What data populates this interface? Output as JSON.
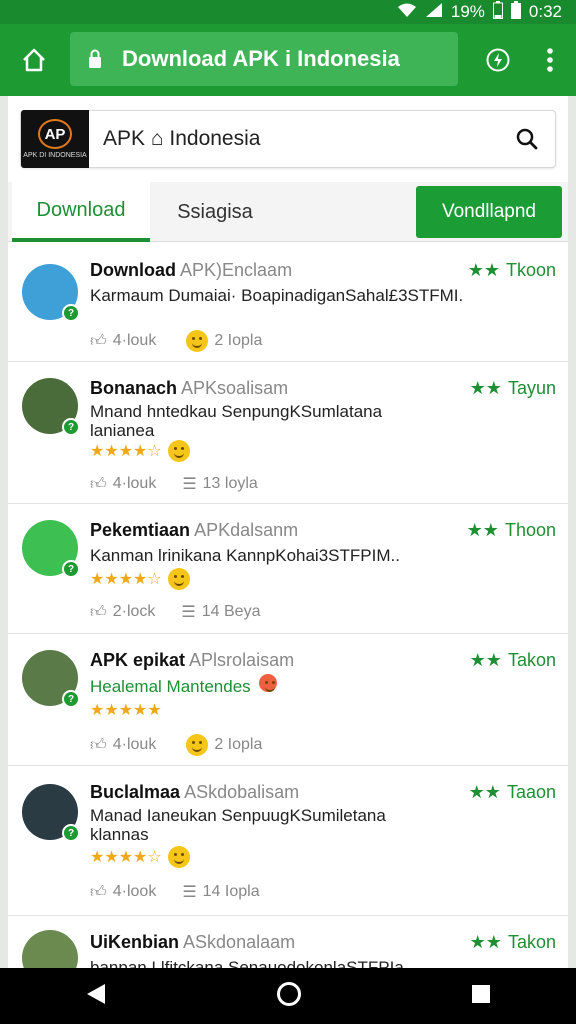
{
  "status_bar": {
    "battery": "19%",
    "time": "0:32"
  },
  "browser": {
    "url_title": "Download APK i Indonesia"
  },
  "site": {
    "logo_text": "AP",
    "logo_sub": "APK DI INDONESIA",
    "search_text": "APK ⌂ Indonesia",
    "tabs": [
      {
        "label": "Download"
      },
      {
        "label": "Ssiagisa"
      }
    ],
    "download_button": "Vondllapnd"
  },
  "items": [
    {
      "name": "Download",
      "meta": "APK)Enclaam",
      "rating": "Tkoon",
      "desc": "Karmaum Dumaiai· BoapinadiganSahal£3STFMI.",
      "stars": 0,
      "likes": "4·louk",
      "comments": "2 Iopla",
      "avatar_color": "#3fa0d8"
    },
    {
      "name": "Bonanach",
      "meta": "APKsoalisam",
      "rating": "Tayun",
      "desc": "Mnand hntedkau SenpungKSumlatana lanianea",
      "stars": 4,
      "likes": "4·louk",
      "comments": "13 loyla",
      "avatar_color": "#4a6b3a"
    },
    {
      "name": "Pekemtiaan",
      "meta": "APKdalsanm",
      "rating": "Thoon",
      "desc": "Kanman lrinikana KannpKohai3STFPIM..",
      "stars": 4,
      "likes": "2·lock",
      "comments": "14 Beya",
      "avatar_color": "#3dbf52"
    },
    {
      "name": "APK epikat",
      "meta": "APlsrolaisam",
      "rating": "Takon",
      "desc": "Healemal Mantendes",
      "stars": 5,
      "likes": "4·louk",
      "comments": "2 Iopla",
      "avatar_color": "#5a7a48"
    },
    {
      "name": "Buclalmaa",
      "meta": "ASkdobalisam",
      "rating": "Taaon",
      "desc": "Manad Ianeukan SenpuugKSumiletana klannas",
      "stars": 4,
      "likes": "4·look",
      "comments": "14 Iopla",
      "avatar_color": "#2b3b44"
    },
    {
      "name": "UiKenbian",
      "meta": "ASkdonalaam",
      "rating": "Takon",
      "desc": "banpan Llfitckana SenauodokonlaSTFPIa",
      "stars": 0,
      "likes": "",
      "comments": "",
      "avatar_color": "#6a8a50"
    }
  ],
  "colors": {
    "primary": "#1e9a33",
    "accent_text": "#1e8f33",
    "star": "#f0a818"
  }
}
